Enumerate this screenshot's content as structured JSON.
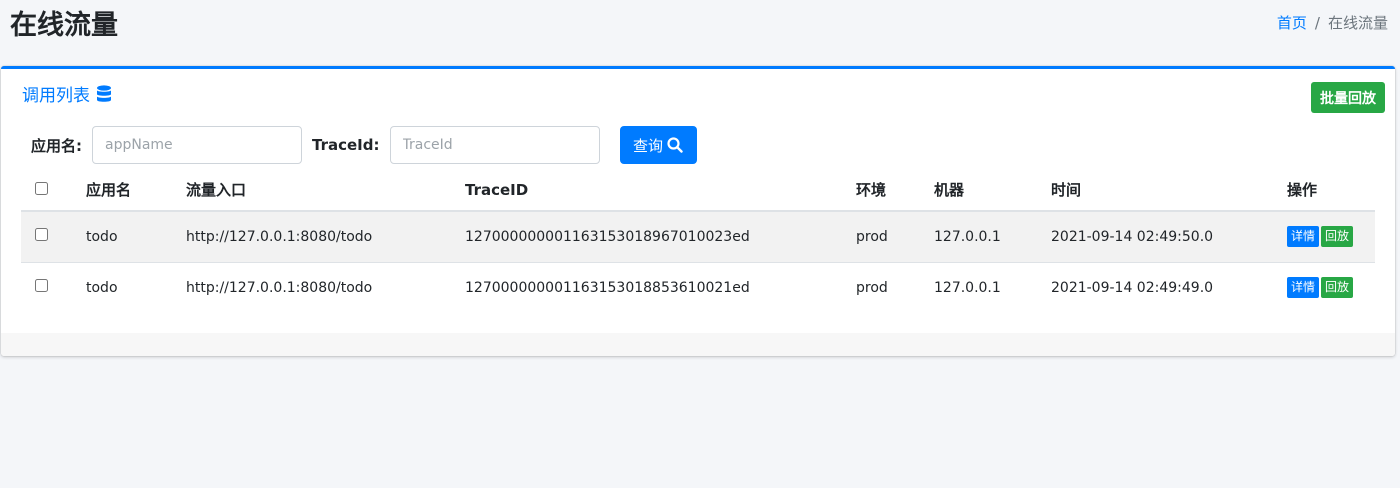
{
  "header": {
    "title": "在线流量",
    "breadcrumb": {
      "home": "首页",
      "separator": "/",
      "current": "在线流量"
    }
  },
  "card": {
    "title": "调用列表",
    "title_icon": "database-icon",
    "batch_button": "批量回放",
    "filters": {
      "app_label": "应用名:",
      "app_placeholder": "appName",
      "app_value": "",
      "trace_label": "TraceId:",
      "trace_placeholder": "TraceId",
      "trace_value": "",
      "query_button": "查询",
      "query_icon": "search-icon"
    },
    "table": {
      "columns": [
        "应用名",
        "流量入口",
        "TraceID",
        "环境",
        "机器",
        "时间",
        "操作"
      ],
      "rows": [
        {
          "app": "todo",
          "entry": "http://127.0.0.1:8080/todo",
          "trace_id": "12700000000116315301896701002 3ed",
          "env": "prod",
          "host": "127.0.0.1",
          "time": "2021-09-14 02:49:50.0",
          "detail": "详情",
          "replay": "回放"
        },
        {
          "app": "todo",
          "entry": "http://127.0.0.1:8080/todo",
          "trace_id": "127000000001163153018853610021ed",
          "env": "prod",
          "host": "127.0.0.1",
          "time": "2021-09-14 02:49:49.0",
          "detail": "详情",
          "replay": "回放"
        }
      ]
    }
  },
  "colors": {
    "primary": "#007bff",
    "success": "#28a745"
  }
}
